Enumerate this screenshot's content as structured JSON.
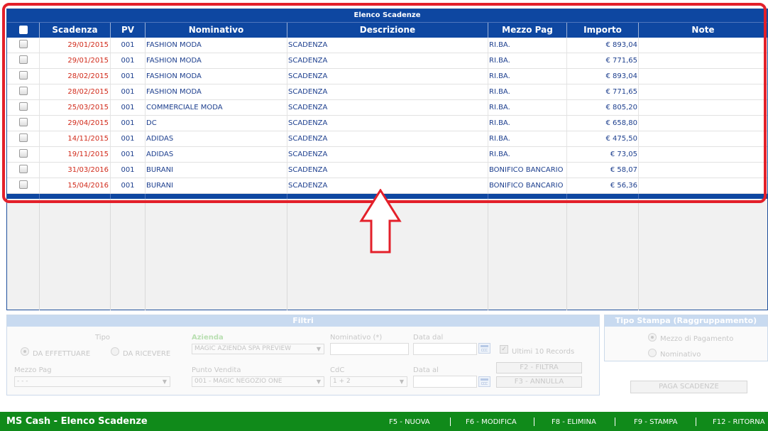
{
  "grid": {
    "title": "Elenco Scadenze",
    "headers": {
      "scadenza": "Scadenza",
      "pv": "PV",
      "nominativo": "Nominativo",
      "descrizione": "Descrizione",
      "mezzo_pag": "Mezzo Pag",
      "importo": "Importo",
      "note": "Note"
    },
    "rows": [
      {
        "scadenza": "29/01/2015",
        "pv": "001",
        "nominativo": "FASHION MODA",
        "descrizione": "SCADENZA",
        "mezzo_pag": "RI.BA.",
        "importo": "€ 893,04",
        "note": ""
      },
      {
        "scadenza": "29/01/2015",
        "pv": "001",
        "nominativo": "FASHION MODA",
        "descrizione": "SCADENZA",
        "mezzo_pag": "RI.BA.",
        "importo": "€ 771,65",
        "note": ""
      },
      {
        "scadenza": "28/02/2015",
        "pv": "001",
        "nominativo": "FASHION MODA",
        "descrizione": "SCADENZA",
        "mezzo_pag": "RI.BA.",
        "importo": "€ 893,04",
        "note": ""
      },
      {
        "scadenza": "28/02/2015",
        "pv": "001",
        "nominativo": "FASHION MODA",
        "descrizione": "SCADENZA",
        "mezzo_pag": "RI.BA.",
        "importo": "€ 771,65",
        "note": ""
      },
      {
        "scadenza": "25/03/2015",
        "pv": "001",
        "nominativo": "COMMERCIALE MODA",
        "descrizione": "SCADENZA",
        "mezzo_pag": "RI.BA.",
        "importo": "€ 805,20",
        "note": ""
      },
      {
        "scadenza": "29/04/2015",
        "pv": "001",
        "nominativo": "DC",
        "descrizione": "SCADENZA",
        "mezzo_pag": "RI.BA.",
        "importo": "€ 658,80",
        "note": ""
      },
      {
        "scadenza": "14/11/2015",
        "pv": "001",
        "nominativo": "ADIDAS",
        "descrizione": "SCADENZA",
        "mezzo_pag": "RI.BA.",
        "importo": "€ 475,50",
        "note": ""
      },
      {
        "scadenza": "19/11/2015",
        "pv": "001",
        "nominativo": "ADIDAS",
        "descrizione": "SCADENZA",
        "mezzo_pag": "RI.BA.",
        "importo": "€ 73,05",
        "note": ""
      },
      {
        "scadenza": "31/03/2016",
        "pv": "001",
        "nominativo": "BURANI",
        "descrizione": "SCADENZA",
        "mezzo_pag": "BONIFICO BANCARIO",
        "importo": "€ 58,07",
        "note": ""
      },
      {
        "scadenza": "15/04/2016",
        "pv": "001",
        "nominativo": "BURANI",
        "descrizione": "SCADENZA",
        "mezzo_pag": "BONIFICO BANCARIO",
        "importo": "€ 56,36",
        "note": ""
      }
    ]
  },
  "filters": {
    "title": "Filtri",
    "tipo_label": "Tipo",
    "radio_effettuare": "DA EFFETTUARE",
    "radio_ricevere": "DA RICEVERE",
    "azienda_label": "Azienda",
    "azienda_value": "MAGIC AZIENDA SPA PREVIEW",
    "nominativo_label": "Nominativo (*)",
    "data_dal_label": "Data dal",
    "ultimi_label": "Ultimi 10 Records",
    "mezzo_pag_label": "Mezzo Pag",
    "mezzo_pag_value": "- - -",
    "punto_vendita_label": "Punto Vendita",
    "punto_vendita_value": "001 - MAGIC NEGOZIO ONE",
    "cdc_label": "CdC",
    "cdc_value": "1 + 2",
    "data_al_label": "Data al",
    "filtra_button": "F2 - FILTRA",
    "annulla_button": "F3 - ANNULLA"
  },
  "tipo_stampa": {
    "title": "Tipo Stampa (Raggruppamento)",
    "option_mezzo": "Mezzo di Pagamento",
    "option_nominativo": "Nominativo"
  },
  "paga_button": "PAGA SCADENZE",
  "statusbar": {
    "app_title": "MS Cash - Elenco Scadenze",
    "keys": [
      "F5 - NUOVA",
      "F6 - MODIFICA",
      "F8 - ELIMINA",
      "F9 - STAMPA",
      "F12 - RITORNA"
    ]
  },
  "colors": {
    "header_blue": "#0e47a1",
    "date_red": "#d12a1a",
    "text_blue": "#1d3f8e",
    "highlight_red": "#e3202a",
    "statusbar_green": "#108a1a"
  }
}
